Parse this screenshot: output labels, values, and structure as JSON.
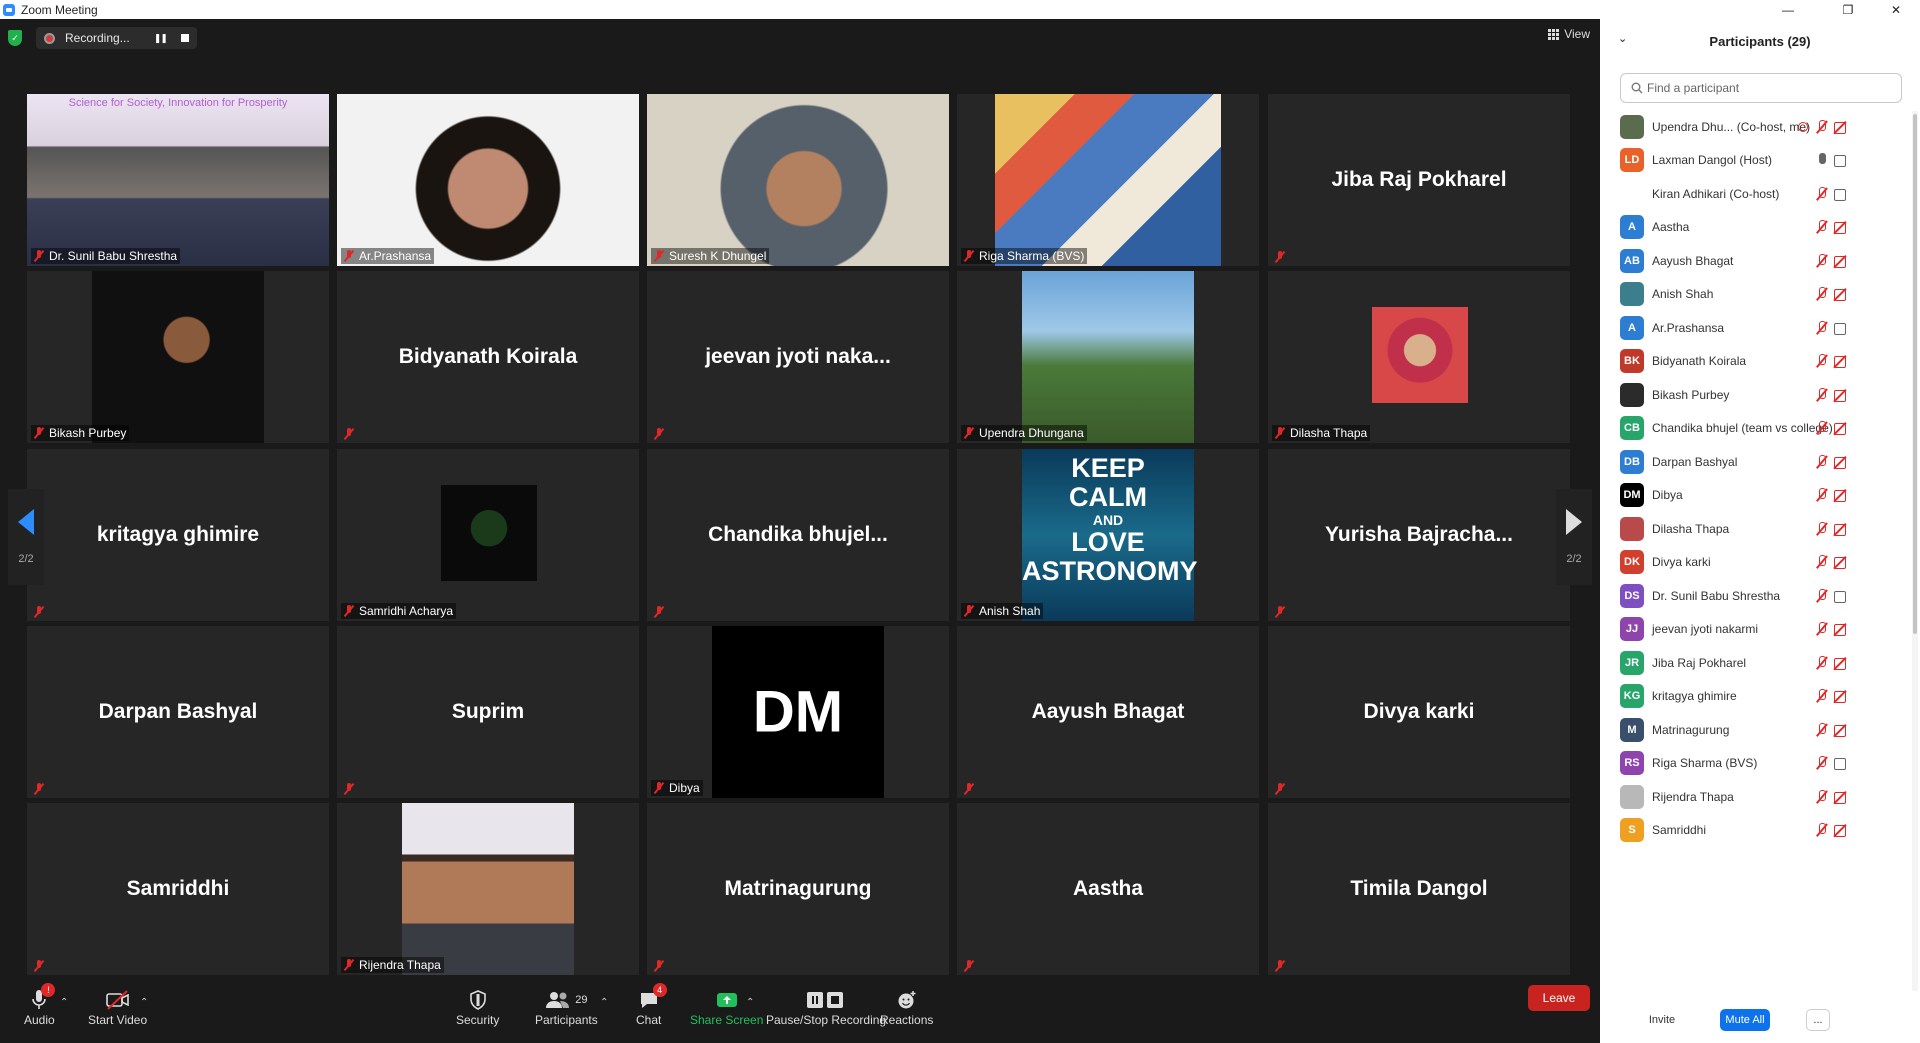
{
  "window": {
    "title": "Zoom Meeting"
  },
  "topbar": {
    "recording_label": "Recording...",
    "view_label": "View"
  },
  "gallery": {
    "page_indicator_left": "2/2",
    "page_indicator_right": "2/2",
    "tiles": [
      {
        "name": "Dr. Sunil Babu Shrestha",
        "big": "",
        "video": true,
        "video_caption": "Science for Society, Innovation for Prosperity"
      },
      {
        "name": "Ar.Prashansa",
        "big": "",
        "video": true
      },
      {
        "name": "Suresh K Dhungel",
        "big": "",
        "video": true
      },
      {
        "name": "Riga Sharma (BVS)",
        "big": "",
        "video": true
      },
      {
        "name": "",
        "big": "Jiba Raj Pokharel",
        "video": false
      },
      {
        "name": "Bikash Purbey",
        "big": "",
        "video": true
      },
      {
        "name": "",
        "big": "Bidyanath Koirala",
        "video": false
      },
      {
        "name": "",
        "big": "jeevan jyoti naka...",
        "video": false
      },
      {
        "name": "Upendra Dhungana",
        "big": "",
        "video": true
      },
      {
        "name": "Dilasha Thapa",
        "big": "",
        "video": true
      },
      {
        "name": "",
        "big": "kritagya ghimire",
        "video": false
      },
      {
        "name": "Samridhi Acharya",
        "big": "",
        "video": true
      },
      {
        "name": "",
        "big": "Chandika  bhujel...",
        "video": false
      },
      {
        "name": "Anish Shah",
        "big": "",
        "video": true,
        "poster_lines": [
          "KEEP",
          "CALM",
          "AND",
          "LOVE",
          "ASTRONOMY"
        ]
      },
      {
        "name": "",
        "big": "Yurisha  Bajracha...",
        "video": false
      },
      {
        "name": "",
        "big": "Darpan Bashyal",
        "video": false
      },
      {
        "name": "",
        "big": "Suprim",
        "video": false
      },
      {
        "name": "Dibya",
        "big": "",
        "video": true,
        "initials": "DM"
      },
      {
        "name": "",
        "big": "Aayush Bhagat",
        "video": false
      },
      {
        "name": "",
        "big": "Divya karki",
        "video": false
      },
      {
        "name": "",
        "big": "Samriddhi",
        "video": false
      },
      {
        "name": "Rijendra Thapa",
        "big": "",
        "video": true
      },
      {
        "name": "",
        "big": "Matrinagurung",
        "video": false
      },
      {
        "name": "",
        "big": "Aastha",
        "video": false
      },
      {
        "name": "",
        "big": "Timila Dangol",
        "video": false
      }
    ]
  },
  "toolbar": {
    "audio": "Audio",
    "audio_badge": "!",
    "start_video": "Start Video",
    "security": "Security",
    "participants": "Participants",
    "participants_count": "29",
    "chat": "Chat",
    "chat_badge": "4",
    "share_screen": "Share Screen",
    "pause_stop": "Pause/Stop Recording",
    "reactions": "Reactions",
    "leave": "Leave"
  },
  "panel": {
    "title": "Participants (29)",
    "search_placeholder": "Find a participant",
    "participants": [
      {
        "name": "Upendra Dhu...  (Co-host, me)",
        "initials": "",
        "color": "#5a6b4e",
        "mic": "off",
        "cam": "off"
      },
      {
        "name": "Laxman Dangol (Host)",
        "initials": "LD",
        "color": "#e8622a",
        "mic": "on",
        "cam": "on"
      },
      {
        "name": "Kiran Adhikari (Co-host)",
        "initials": "",
        "color": "#ffffff",
        "mic": "off",
        "cam": "on"
      },
      {
        "name": "Aastha",
        "initials": "A",
        "color": "#2d7dd2",
        "mic": "off",
        "cam": "off"
      },
      {
        "name": "Aayush Bhagat",
        "initials": "AB",
        "color": "#2d7dd2",
        "mic": "off",
        "cam": "off"
      },
      {
        "name": "Anish Shah",
        "initials": "",
        "color": "#3b7f8c",
        "mic": "off",
        "cam": "off"
      },
      {
        "name": "Ar.Prashansa",
        "initials": "A",
        "color": "#2d7dd2",
        "mic": "off",
        "cam": "on"
      },
      {
        "name": "Bidyanath Koirala",
        "initials": "BK",
        "color": "#c0392b",
        "mic": "off",
        "cam": "off"
      },
      {
        "name": "Bikash Purbey",
        "initials": "",
        "color": "#2b2b2b",
        "mic": "off",
        "cam": "off"
      },
      {
        "name": "Chandika bhujel (team vs college)",
        "initials": "CB",
        "color": "#27a56a",
        "mic": "off",
        "cam": "off"
      },
      {
        "name": "Darpan Bashyal",
        "initials": "DB",
        "color": "#2d7dd2",
        "mic": "off",
        "cam": "off"
      },
      {
        "name": "Dibya",
        "initials": "DM",
        "color": "#000000",
        "mic": "off",
        "cam": "off"
      },
      {
        "name": "Dilasha Thapa",
        "initials": "",
        "color": "#b94a4a",
        "mic": "off",
        "cam": "off"
      },
      {
        "name": "Divya karki",
        "initials": "DK",
        "color": "#d0402c",
        "mic": "off",
        "cam": "off"
      },
      {
        "name": "Dr. Sunil Babu Shrestha",
        "initials": "DS",
        "color": "#7d4fc0",
        "mic": "off",
        "cam": "on"
      },
      {
        "name": "jeevan jyoti nakarmi",
        "initials": "JJ",
        "color": "#8e44ad",
        "mic": "off",
        "cam": "off"
      },
      {
        "name": "Jiba Raj Pokharel",
        "initials": "JR",
        "color": "#27a56a",
        "mic": "off",
        "cam": "off"
      },
      {
        "name": "kritagya ghimire",
        "initials": "KG",
        "color": "#27a56a",
        "mic": "off",
        "cam": "off"
      },
      {
        "name": "Matrinagurung",
        "initials": "M",
        "color": "#3a4f6b",
        "mic": "off",
        "cam": "off"
      },
      {
        "name": "Riga Sharma (BVS)",
        "initials": "RS",
        "color": "#8e44ad",
        "mic": "off",
        "cam": "on"
      },
      {
        "name": "Rijendra Thapa",
        "initials": "",
        "color": "#b8b8b8",
        "mic": "off",
        "cam": "off"
      },
      {
        "name": "Samriddhi",
        "initials": "S",
        "color": "#f0a020",
        "mic": "off",
        "cam": "off"
      }
    ],
    "invite": "Invite",
    "mute_all": "Mute All",
    "more": "..."
  }
}
